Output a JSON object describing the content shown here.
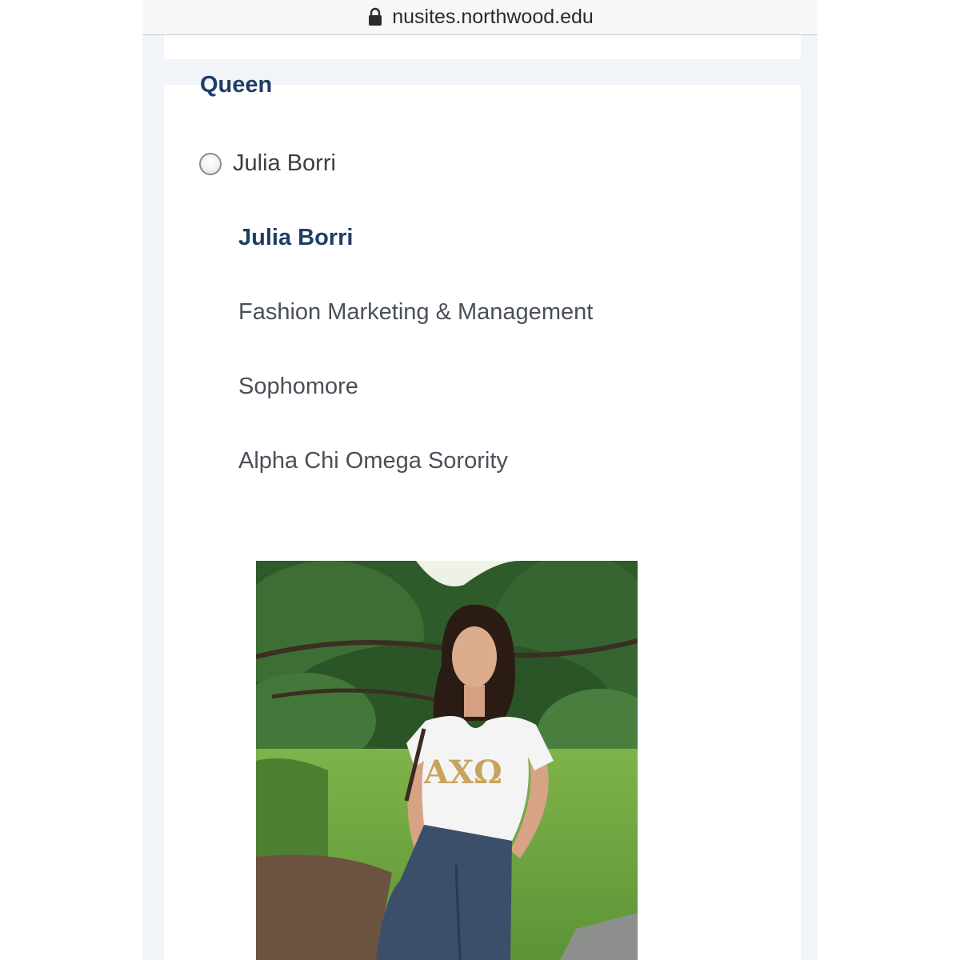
{
  "browser": {
    "url": "nusites.northwood.edu",
    "lock_icon": "lock-icon"
  },
  "section": {
    "title": "Queen"
  },
  "candidate": {
    "option_label": "Julia Borri",
    "name": "Julia Borri",
    "major": "Fashion Marketing & Management",
    "class_year": "Sophomore",
    "organization": "Alpha Chi Omega Sorority",
    "photo": {
      "shirt_letters": "ΑΧΩ"
    }
  },
  "colors": {
    "heading": "#1f3e66",
    "text": "#4a5058",
    "page_bg": "#f1f4f8",
    "shirt_letters": "#c8a35e"
  }
}
